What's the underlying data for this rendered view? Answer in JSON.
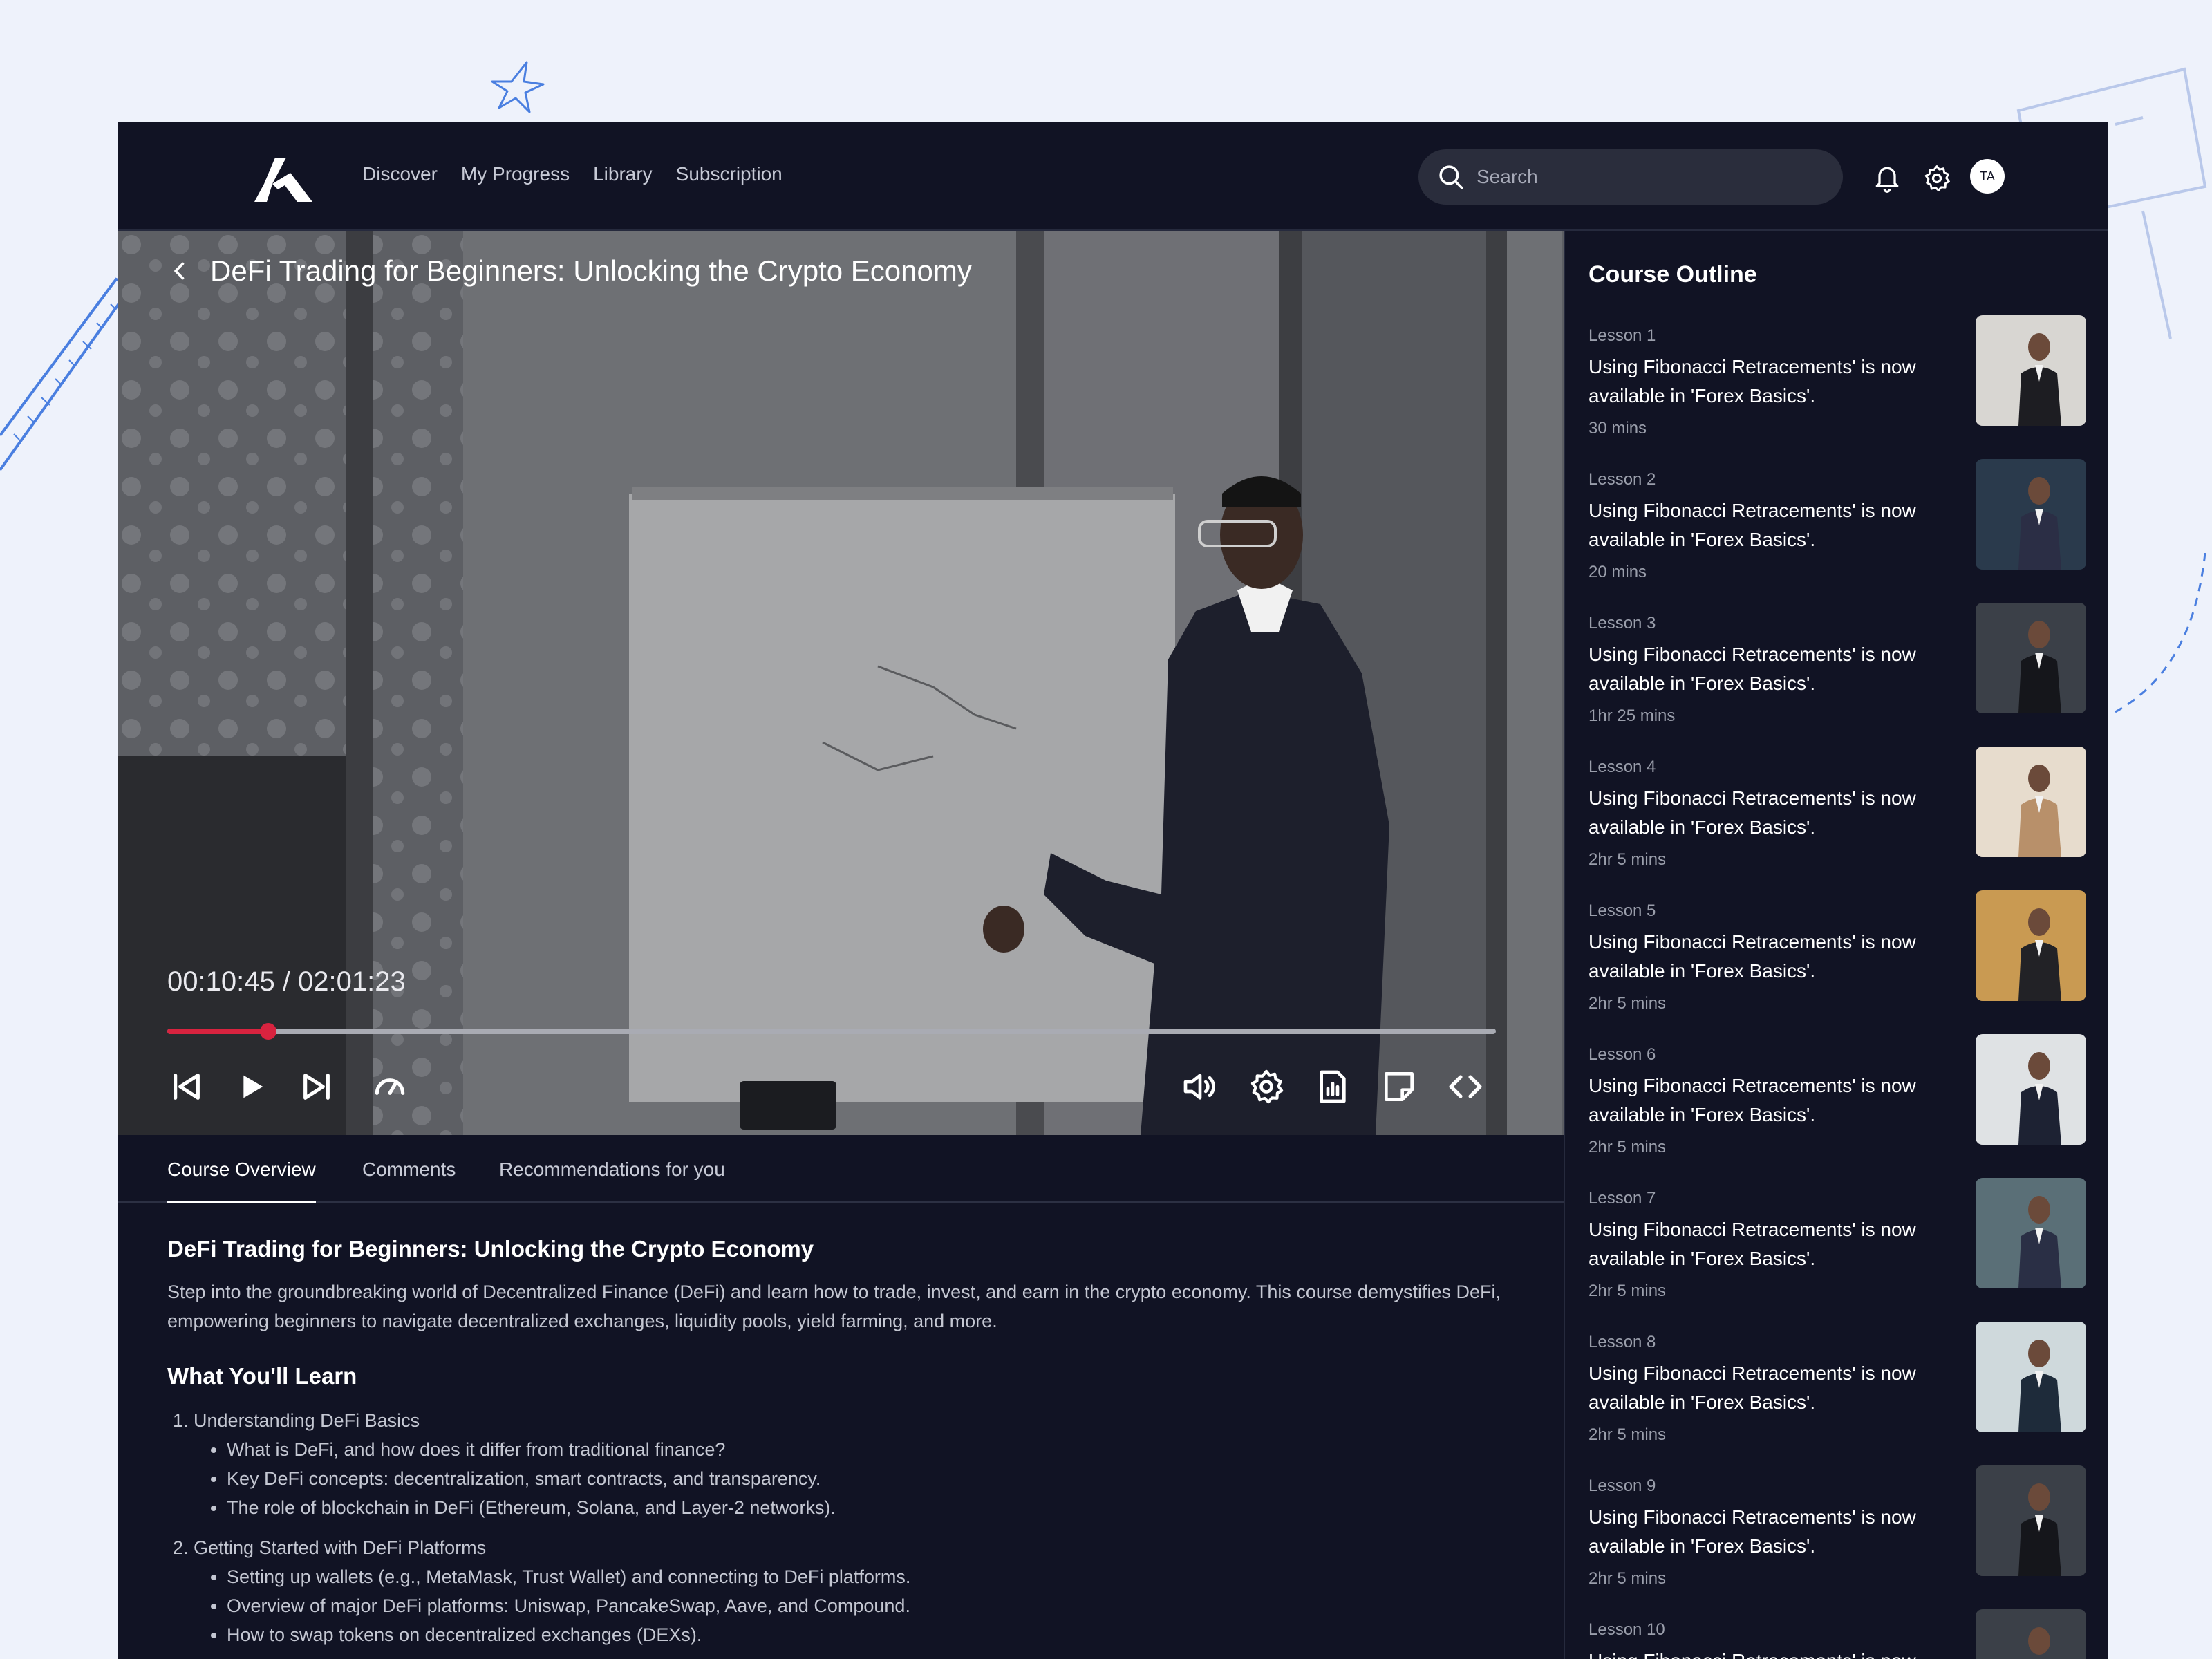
{
  "header": {
    "nav": [
      "Discover",
      "My Progress",
      "Library",
      "Subscription"
    ],
    "search_placeholder": "Search",
    "avatar_initials": "TA"
  },
  "video": {
    "title": "DeFi Trading for Beginners: Unlocking the Crypto Economy",
    "time_display": "00:10:45 / 02:01:23",
    "progress_fraction": 0.076
  },
  "tabs": [
    "Course Overview",
    "Comments",
    "Recommendations for you"
  ],
  "content": {
    "title": "DeFi Trading for Beginners: Unlocking the Crypto Economy",
    "description": "Step into the groundbreaking world of Decentralized Finance (DeFi) and learn how to trade, invest, and earn in the crypto economy. This course demystifies DeFi, empowering beginners to navigate decentralized exchanges, liquidity pools, yield farming, and more.",
    "learn_heading": "What You'll Learn",
    "learn": [
      {
        "heading": "1. Understanding DeFi Basics",
        "points": [
          "What is DeFi, and how does it differ from traditional finance?",
          "Key DeFi concepts: decentralization, smart contracts, and transparency.",
          "The role of blockchain in DeFi (Ethereum, Solana, and Layer-2 networks)."
        ]
      },
      {
        "heading": "2. Getting Started with DeFi Platforms",
        "points": [
          "Setting up wallets (e.g., MetaMask, Trust Wallet) and connecting to DeFi platforms.",
          "Overview of major DeFi platforms: Uniswap, PancakeSwap, Aave, and Compound.",
          "How to swap tokens on decentralized exchanges (DEXs)."
        ]
      }
    ]
  },
  "sidebar": {
    "title": "Course Outline",
    "lessons": [
      {
        "num": "Lesson 1",
        "title": "Using Fibonacci Retracements' is now available in 'Forex Basics'.",
        "duration": "30 mins",
        "thumb_bg": "#d8d6d2",
        "thumb_suit": "#1d1d22"
      },
      {
        "num": "Lesson 2",
        "title": "Using Fibonacci Retracements' is now available in 'Forex Basics'.",
        "duration": "20 mins",
        "thumb_bg": "#2a3a4c",
        "thumb_suit": "#2b2e45"
      },
      {
        "num": "Lesson 3",
        "title": "Using Fibonacci Retracements' is now available in 'Forex Basics'.",
        "duration": "1hr 25 mins",
        "thumb_bg": "#3b4048",
        "thumb_suit": "#15161b"
      },
      {
        "num": "Lesson 4",
        "title": "Using Fibonacci Retracements' is now available in 'Forex Basics'.",
        "duration": "2hr 5 mins",
        "thumb_bg": "#e7dccd",
        "thumb_suit": "#b8906a"
      },
      {
        "num": "Lesson 5",
        "title": "Using Fibonacci Retracements' is now available in 'Forex Basics'.",
        "duration": "2hr 5 mins",
        "thumb_bg": "#c99a52",
        "thumb_suit": "#222226"
      },
      {
        "num": "Lesson 6",
        "title": "Using Fibonacci Retracements' is now available in 'Forex Basics'.",
        "duration": "2hr 5 mins",
        "thumb_bg": "#dfe2e4",
        "thumb_suit": "#1d2233"
      },
      {
        "num": "Lesson 7",
        "title": "Using Fibonacci Retracements' is now available in 'Forex Basics'.",
        "duration": "2hr 5 mins",
        "thumb_bg": "#5a6f77",
        "thumb_suit": "#2a2f45"
      },
      {
        "num": "Lesson 8",
        "title": "Using Fibonacci Retracements' is now available in 'Forex Basics'.",
        "duration": "2hr 5 mins",
        "thumb_bg": "#cfd9dc",
        "thumb_suit": "#1e2b3a"
      },
      {
        "num": "Lesson 9",
        "title": "Using Fibonacci Retracements' is now available in 'Forex Basics'.",
        "duration": "2hr 5 mins",
        "thumb_bg": "#3b4048",
        "thumb_suit": "#15161b"
      },
      {
        "num": "Lesson 10",
        "title": "Using Fibonacci Retracements' is now available in 'Forex Basics'.",
        "duration": "",
        "thumb_bg": "#3b4048",
        "thumb_suit": "#15161b"
      }
    ]
  },
  "colors": {
    "app_bg": "#111324",
    "accent_red": "#d8233f",
    "page_bg": "#eef2fb"
  },
  "icons": {
    "video_controls_left": [
      "skip-back-icon",
      "play-icon",
      "skip-forward-icon",
      "speed-icon"
    ],
    "video_controls_right": [
      "volume-icon",
      "settings-icon",
      "report-icon",
      "note-icon",
      "embed-icon"
    ]
  }
}
